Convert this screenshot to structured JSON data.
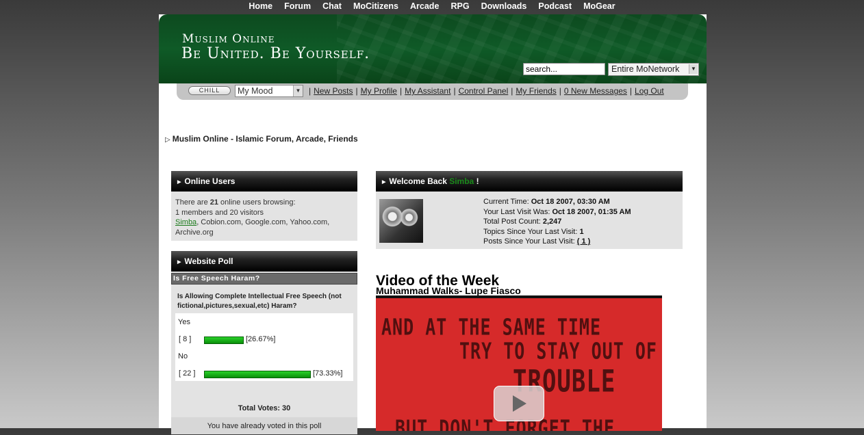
{
  "topnav": [
    "Home",
    "Forum",
    "Chat",
    "MoCitizens",
    "Arcade",
    "RPG",
    "Downloads",
    "Podcast",
    "MoGear"
  ],
  "banner": {
    "site_name": "Muslim Online",
    "tagline": "Be United. Be Yourself.",
    "search_value": "search...",
    "search_scope": "Entire MoNetwork"
  },
  "userbar": {
    "mood_button": "CHILL",
    "mood_select": "My Mood",
    "links": [
      "New Posts",
      "My Profile",
      "My Assistant",
      "Control Panel",
      "My Friends",
      "0 New Messages",
      "Log Out"
    ]
  },
  "breadcrumb": "Muslim Online - Islamic Forum, Arcade, Friends",
  "online_users": {
    "title": "Online Users",
    "line1_pre": "There are ",
    "count": "21",
    "line1_post": " online users browsing:",
    "line2": "1 members and 20 visitors",
    "member": "Simba",
    "others": ", Cobion.com, Google.com, Yahoo.com,",
    "others2": "Archive.org"
  },
  "poll": {
    "title": "Website Poll",
    "header": "Is Free Speech Haram?",
    "question": "Is Allowing Complete Intellectual Free Speech (not fictional,pictures,sexual,etc) Haram?",
    "options": [
      {
        "label": "Yes",
        "count": "[ 8 ]",
        "percent": "[26.67%]",
        "fraction": 0.2667
      },
      {
        "label": "No",
        "count": "[ 22 ]",
        "percent": "[73.33%]",
        "fraction": 0.7333
      }
    ],
    "total": "Total Votes: 30",
    "status": "You have already voted in this poll"
  },
  "welcome": {
    "title_pre": "Welcome Back ",
    "username": "Simba",
    "title_post": " !",
    "current_time_label": "Current Time: ",
    "current_time": "Oct 18 2007, 03:30 AM",
    "last_visit_label": "Your Last Visit Was: ",
    "last_visit": "Oct 18 2007, 01:35 AM",
    "post_count_label": "Total Post Count: ",
    "post_count": "2,247",
    "topics_label": "Topics Since Your Last Visit: ",
    "topics": "1",
    "posts_label": "Posts Since Your Last Visit: ",
    "posts": "( 1 )"
  },
  "video": {
    "heading": "Video of the Week",
    "subtitle": "Muhammad Walks- Lupe Fiasco",
    "frame_lines": [
      "AND AT THE SAME TIME",
      "TRY TO STAY OUT OF",
      "TROUBLE",
      "BUT DON'T FORGET THE"
    ]
  }
}
